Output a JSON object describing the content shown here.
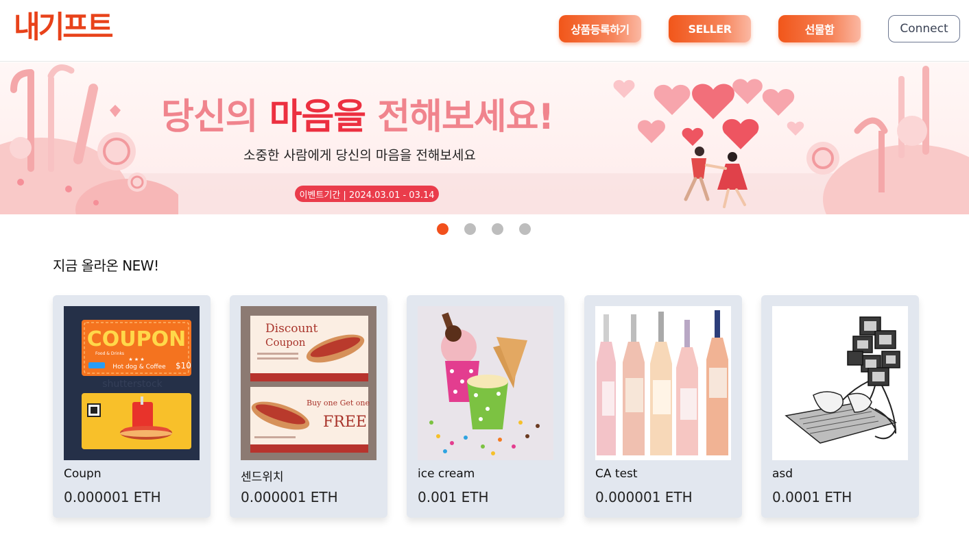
{
  "header": {
    "logo": "내기프트",
    "register_label": "상품등록하기",
    "seller_label": "SELLER",
    "gift_label": "선물함",
    "connect_label": "Connect"
  },
  "banner": {
    "title_part1": "당신의 ",
    "title_part2": "마음을",
    "title_part3": " 전해보세요!",
    "subtitle": "소중한 사람에게 당신의 마음을 전해보세요",
    "event_period": "이벤트기간 | 2024.03.01 - 03.14"
  },
  "carousel": {
    "slide_count": 4,
    "active_index": 0
  },
  "section": {
    "title": "지금 올라온 NEW!"
  },
  "products": [
    {
      "name": "Coupn",
      "price": "0.000001 ETH",
      "image": "coupon-image"
    },
    {
      "name": "센드위치",
      "price": "0.000001 ETH",
      "image": "hotdog-coupon-image"
    },
    {
      "name": "ice cream",
      "price": "0.001 ETH",
      "image": "ice-cream-image"
    },
    {
      "name": "CA test",
      "price": "0.000001 ETH",
      "image": "wine-bottles-image"
    },
    {
      "name": "asd",
      "price": "0.0001 ETH",
      "image": "sketch-illustration-image"
    }
  ],
  "colors": {
    "accent": "#f1561a",
    "card_bg": "#e2e7ef",
    "banner_red": "#ec3040"
  }
}
